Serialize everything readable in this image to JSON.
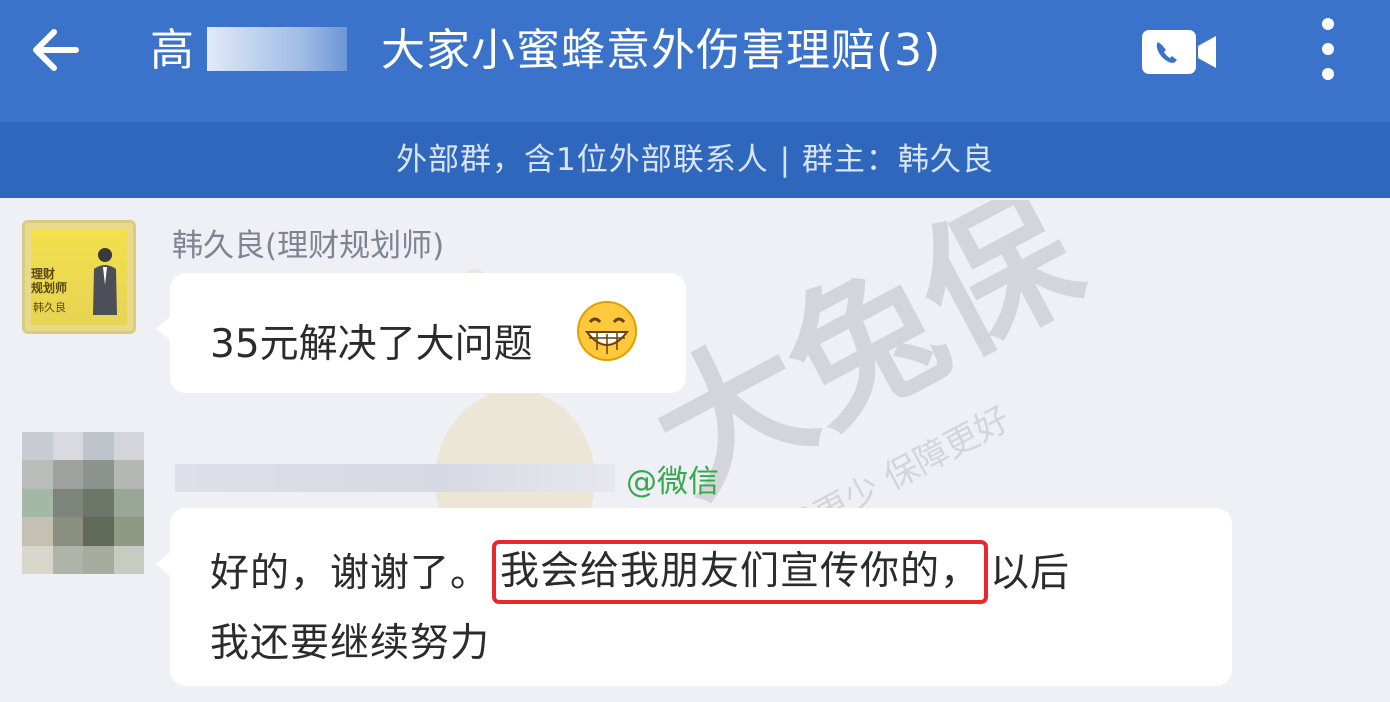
{
  "header": {
    "back_icon": "back-arrow-icon",
    "title_prefix": "高",
    "title_suffix": "大家小蜜蜂意外伤害理赔(3)",
    "video_icon": "video-call-icon",
    "more_icon": "more-vertical-icon",
    "bar_color": "#3a73c9"
  },
  "subheader": {
    "text": "外部群，含1位外部联系人 | 群主：韩久良",
    "bar_color": "#2f67bd"
  },
  "messages": [
    {
      "sender": "韩久良(理财规划师)",
      "avatar_lines": [
        "理财",
        "规划师"
      ],
      "avatar_name": "韩久良",
      "text": "35元解决了大问题",
      "emoji": "grinning-face-icon"
    },
    {
      "sender_tag": "@微信",
      "text_before": "好的，谢谢了。",
      "text_highlight": "我会给我朋友们宣传你的，",
      "text_after": "以后",
      "text_line2": "我还要继续努力",
      "highlight_color": "#e8282c",
      "tag_color": "#37a94d"
    }
  ],
  "watermark": {
    "brand": "大兔保",
    "slogan": "花钱更少 保障更好"
  }
}
